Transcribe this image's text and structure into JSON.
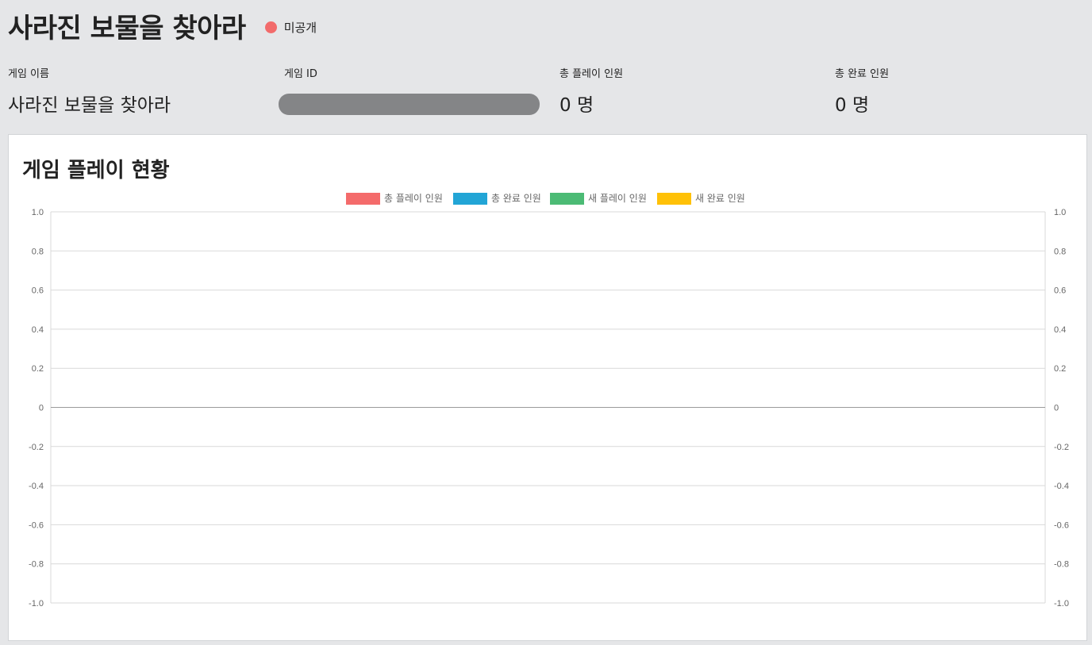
{
  "game": {
    "title": "사라진 보물을 찾아라",
    "status_label": "미공개",
    "status_color": "#f26b6b"
  },
  "stats": {
    "name_label": "게임 이름",
    "name_value": "사라진 보물을 찾아라",
    "id_label": "게임 ID",
    "total_play_label": "총 플레이 인원",
    "total_play_value": "0 명",
    "total_complete_label": "총 완료 인원",
    "total_complete_value": "0 명"
  },
  "panel": {
    "title": "게임 플레이 현황"
  },
  "chart_data": {
    "type": "line",
    "title": "",
    "xlabel": "",
    "ylabel": "",
    "ylim": [
      -1.0,
      1.0
    ],
    "y_ticks": [
      "1.0",
      "0.8",
      "0.6",
      "0.4",
      "0.2",
      "0",
      "-0.2",
      "-0.4",
      "-0.6",
      "-0.8",
      "-1.0"
    ],
    "y_ticks_right": [
      "1.0",
      "0.8",
      "0.6",
      "0.4",
      "0.2",
      "0",
      "-0.2",
      "-0.4",
      "-0.6",
      "-0.8",
      "-1.0"
    ],
    "grid": true,
    "legend_position": "top-center",
    "categories": [],
    "series": [
      {
        "name": "총 플레이 인원",
        "color": "#f46b6b",
        "values": []
      },
      {
        "name": "총 완료 인원",
        "color": "#22a5d6",
        "values": []
      },
      {
        "name": "새 플레이 인원",
        "color": "#4cbb75",
        "values": []
      },
      {
        "name": "새 완료 인원",
        "color": "#ffc107",
        "values": []
      }
    ]
  }
}
